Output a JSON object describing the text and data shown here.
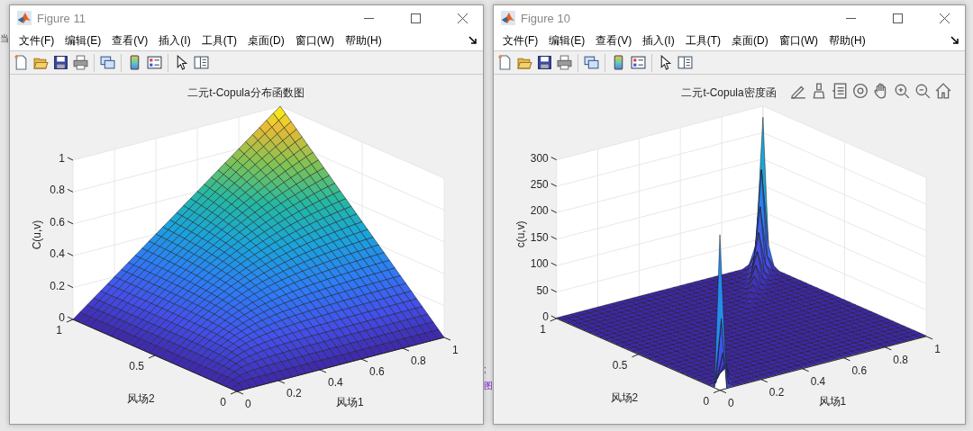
{
  "left_fragments": [
    "当"
  ],
  "middle_fragments": [
    ";",
    "图"
  ],
  "windows": [
    {
      "title": "Figure 11",
      "menu": [
        "文件(F)",
        "编辑(E)",
        "查看(V)",
        "插入(I)",
        "工具(T)",
        "桌面(D)",
        "窗口(W)",
        "帮助(H)"
      ],
      "toolbar": [
        {
          "kind": "new"
        },
        {
          "kind": "open"
        },
        {
          "kind": "save"
        },
        {
          "kind": "print"
        },
        {
          "kind": "sep"
        },
        {
          "kind": "link"
        },
        {
          "kind": "sep"
        },
        {
          "kind": "colorbar"
        },
        {
          "kind": "legend"
        },
        {
          "kind": "sep"
        },
        {
          "kind": "pointer"
        },
        {
          "kind": "inspector"
        }
      ],
      "plot": {
        "kind": "cdf",
        "title": "二元t-Copula分布函数图",
        "zlabel": "C(u,v)",
        "xlabel": "风场1",
        "ylabel": "风场2",
        "xticks": [
          "0",
          "0.2",
          "0.4",
          "0.6",
          "0.8",
          "1"
        ],
        "yticks": [
          "0",
          "0.5",
          "1"
        ],
        "zticks": [
          "1",
          "0.8",
          "0.6",
          "0.4",
          "0.2",
          "0"
        ]
      }
    },
    {
      "title": "Figure 10",
      "menu": [
        "文件(F)",
        "编辑(E)",
        "查看(V)",
        "插入(I)",
        "工具(T)",
        "桌面(D)",
        "窗口(W)",
        "帮助(H)"
      ],
      "toolbar": [
        {
          "kind": "new"
        },
        {
          "kind": "open"
        },
        {
          "kind": "save"
        },
        {
          "kind": "print"
        },
        {
          "kind": "sep"
        },
        {
          "kind": "link"
        },
        {
          "kind": "sep"
        },
        {
          "kind": "colorbar"
        },
        {
          "kind": "legend"
        },
        {
          "kind": "sep"
        },
        {
          "kind": "pointer"
        },
        {
          "kind": "inspector"
        }
      ],
      "axes_toolbar": [
        {
          "kind": "brush-edit"
        },
        {
          "kind": "brush"
        },
        {
          "kind": "datatip"
        },
        {
          "kind": "rotate"
        },
        {
          "kind": "pan"
        },
        {
          "kind": "zoom-in"
        },
        {
          "kind": "zoom-out"
        },
        {
          "kind": "home"
        }
      ],
      "plot": {
        "kind": "density",
        "title": "二元t-Copula密度函",
        "zlabel": "c(u,v)",
        "xlabel": "风场1",
        "ylabel": "风场2",
        "xticks": [
          "0",
          "0.2",
          "0.4",
          "0.6",
          "0.8",
          "1"
        ],
        "yticks": [
          "0",
          "0.5",
          "1"
        ],
        "zticks": [
          "300",
          "250",
          "200",
          "150",
          "100",
          "50",
          "0"
        ]
      }
    }
  ]
}
